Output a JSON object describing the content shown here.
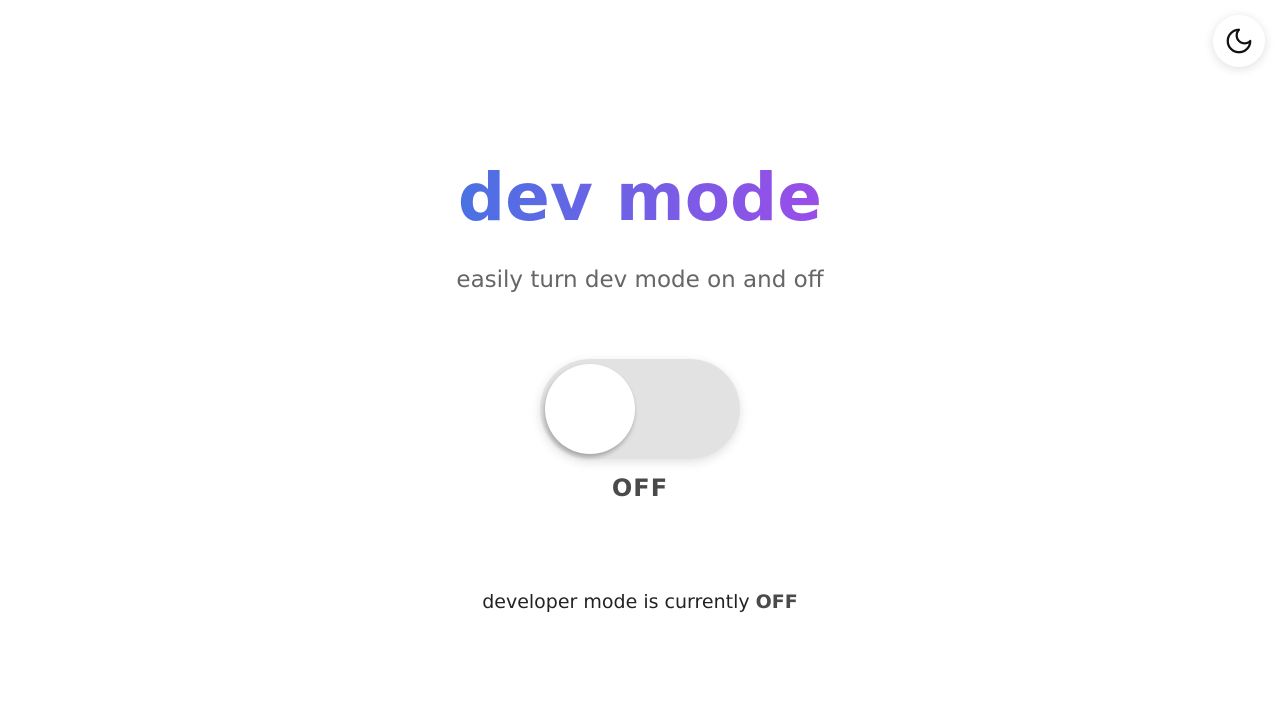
{
  "header": {
    "theme_toggle_icon": "moon-icon"
  },
  "main": {
    "title": "dev mode",
    "subtitle": "easily turn dev mode on and off",
    "toggle": {
      "state_label": "OFF",
      "is_on": false
    },
    "status": {
      "prefix": "developer mode is currently",
      "value": "OFF"
    }
  },
  "colors": {
    "gradient_start": "#4a72e3",
    "gradient_end": "#9a4de8",
    "track_off": "#e2e2e2",
    "label": "#4a4a4a"
  }
}
